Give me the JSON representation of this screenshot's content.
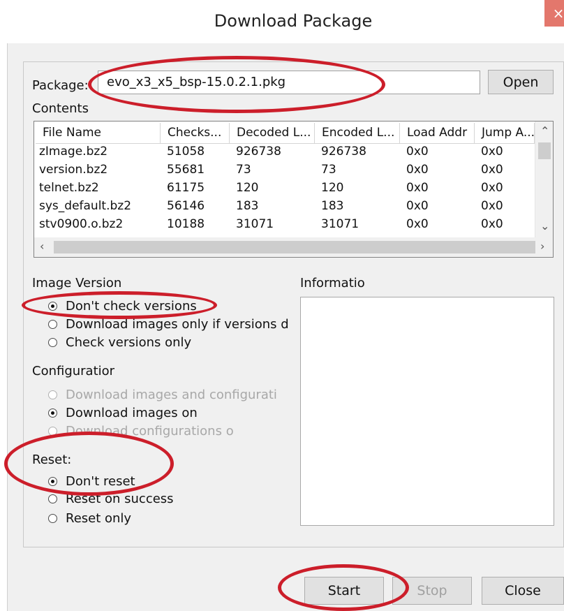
{
  "window": {
    "title": "Download Package",
    "close_glyph": "×"
  },
  "package": {
    "label": "Package:",
    "value": "evo_x3_x5_bsp-15.0.2.1.pkg",
    "open_label": "Open"
  },
  "contents": {
    "label": "Contents",
    "columns": [
      "File Name",
      "Checks...",
      "Decoded L...",
      "Encoded L...",
      "Load Addr",
      "Jump A..."
    ],
    "rows": [
      [
        "zImage.bz2",
        "51058",
        "926738",
        "926738",
        "0x0",
        "0x0"
      ],
      [
        "version.bz2",
        "55681",
        "73",
        "73",
        "0x0",
        "0x0"
      ],
      [
        "telnet.bz2",
        "61175",
        "120",
        "120",
        "0x0",
        "0x0"
      ],
      [
        "sys_default.bz2",
        "56146",
        "183",
        "183",
        "0x0",
        "0x0"
      ],
      [
        "stv0900.o.bz2",
        "10188",
        "31071",
        "31071",
        "0x0",
        "0x0"
      ]
    ]
  },
  "image_version": {
    "label": "Image Version",
    "options": [
      {
        "label": "Don't check versions",
        "checked": true,
        "enabled": true
      },
      {
        "label": "Download images only if versions d",
        "checked": false,
        "enabled": true
      },
      {
        "label": "Check versions only",
        "checked": false,
        "enabled": true
      }
    ]
  },
  "configuration": {
    "label": "Configuratior",
    "options": [
      {
        "label": "Download images and configurati",
        "checked": false,
        "enabled": false
      },
      {
        "label": "Download images on",
        "checked": true,
        "enabled": true
      },
      {
        "label": "Download configurations o",
        "checked": false,
        "enabled": false
      }
    ]
  },
  "reset": {
    "label": "Reset:",
    "options": [
      {
        "label": "Don't reset",
        "checked": true,
        "enabled": true
      },
      {
        "label": "Reset on success",
        "checked": false,
        "enabled": true
      },
      {
        "label": "Reset only",
        "checked": false,
        "enabled": true
      }
    ]
  },
  "information": {
    "label": "Informatio"
  },
  "buttons": {
    "start": "Start",
    "stop": "Stop",
    "close": "Close"
  },
  "colors": {
    "annotation": "#cc1e2a",
    "close_button": "#e3776c"
  }
}
